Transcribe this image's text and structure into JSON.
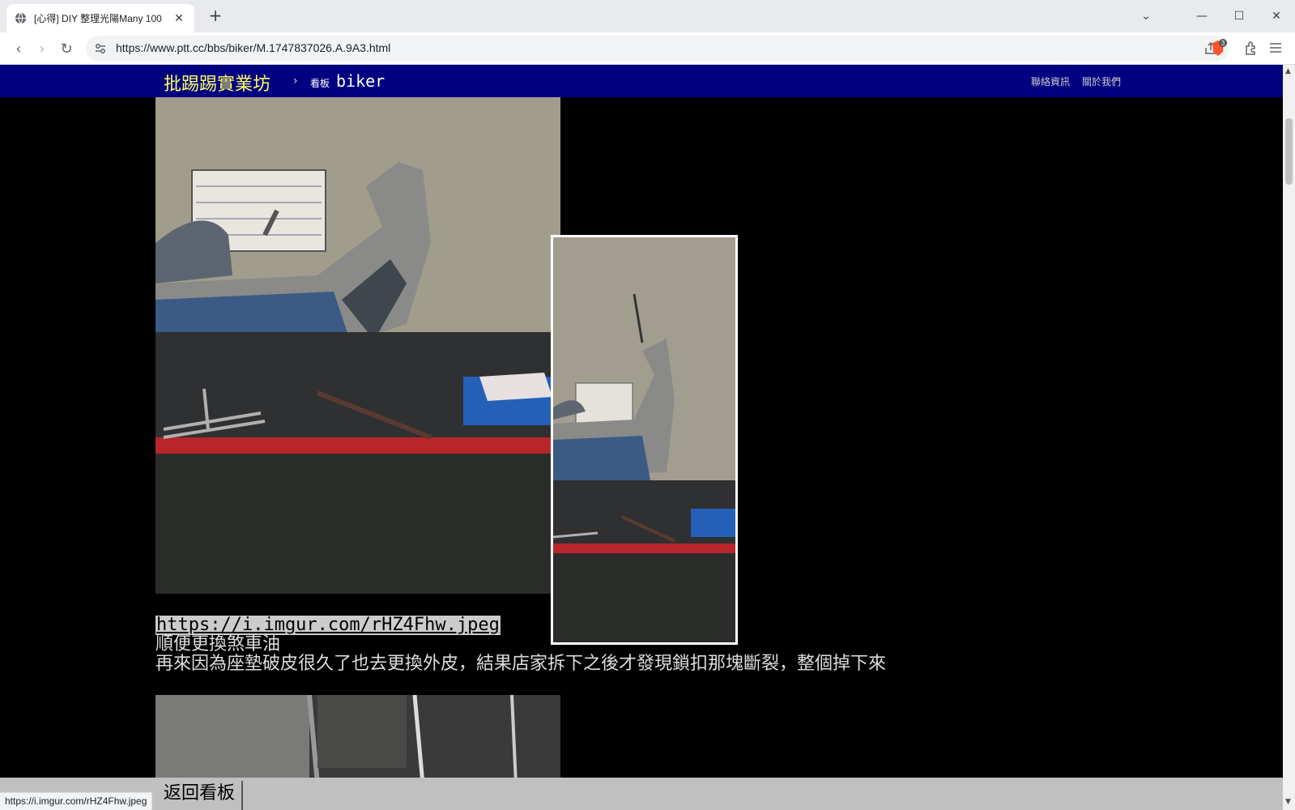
{
  "tab": {
    "title": "[心得] DIY 整理光陽Many 100",
    "close": "✕"
  },
  "newtab": "+",
  "window": {
    "dropdown": "⌄",
    "minimize": "—",
    "maximize": "☐",
    "close": "✕"
  },
  "toolbar": {
    "back": "‹",
    "forward": "›",
    "reload": "↻",
    "url": "https://www.ptt.cc/bbs/biker/M.1747837026.A.9A3.html",
    "brave_badge": "3"
  },
  "ptt": {
    "logo": "批踢踢實業坊",
    "separator": "›",
    "board_label": "看板",
    "board": "biker",
    "contact": "聯絡資訊",
    "about": "關於我們"
  },
  "content": {
    "link": "https://i.imgur.com/rHZ4Fhw.jpeg",
    "line1": "順便更換煞車油",
    "line2": "再來因為座墊破皮很久了也去更換外皮，結果店家拆下之後才發現鎖扣那塊斷裂，整個掉下來"
  },
  "bottom": {
    "back": "返回看板"
  },
  "status": {
    "url": "https://i.imgur.com/rHZ4Fhw.jpeg"
  },
  "scrollbar": {
    "up": "▲",
    "down": "▼"
  }
}
